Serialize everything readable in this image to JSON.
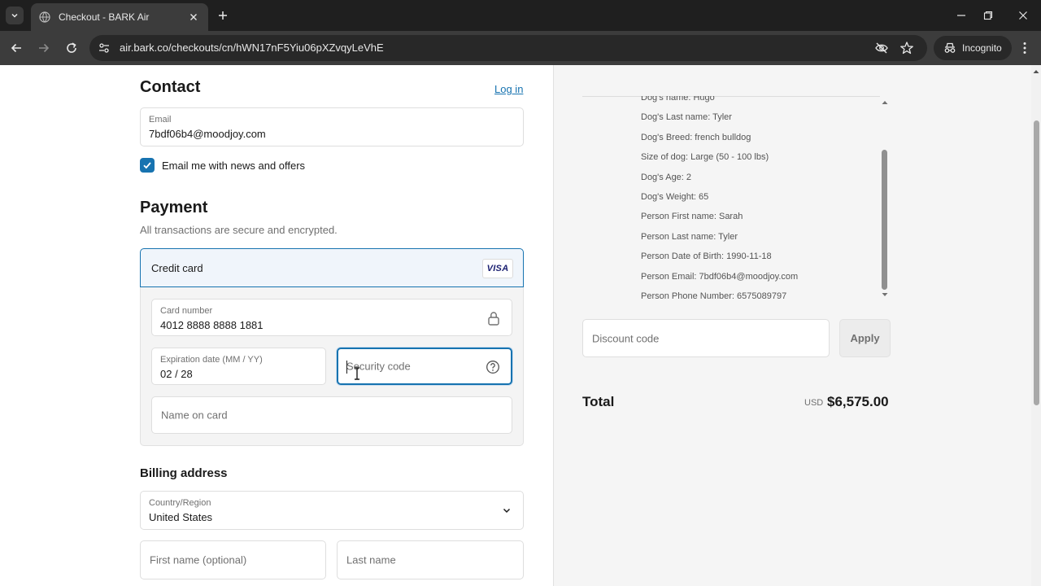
{
  "browser": {
    "tab_title": "Checkout - BARK Air",
    "url": "air.bark.co/checkouts/cn/hWN17nF5Yiu06pXZvqyLeVhE",
    "incognito_label": "Incognito"
  },
  "contact": {
    "title": "Contact",
    "login_label": "Log in",
    "email_label": "Email",
    "email_value": "7bdf06b4@moodjoy.com",
    "newsletter_label": "Email me with news and offers",
    "newsletter_checked": true
  },
  "payment": {
    "title": "Payment",
    "subtitle": "All transactions are secure and encrypted.",
    "method_label": "Credit card",
    "card_brand": "VISA",
    "card_number_label": "Card number",
    "card_number_value": "4012 8888 8888 1881",
    "expiry_label": "Expiration date (MM / YY)",
    "expiry_value": "02 / 28",
    "security_placeholder": "Security code",
    "name_placeholder": "Name on card"
  },
  "billing": {
    "title": "Billing address",
    "country_label": "Country/Region",
    "country_value": "United States",
    "first_name_placeholder": "First name (optional)",
    "last_name_placeholder": "Last name"
  },
  "summary": {
    "attributes": [
      "Dog's name: Hugo",
      "Dog's Last name: Tyler",
      "Dog's Breed: french bulldog",
      "Size of dog: Large (50 - 100 lbs)",
      "Dog's Age: 2",
      "Dog's Weight: 65",
      "Person First name: Sarah",
      "Person Last name: Tyler",
      "Person Date of Birth: 1990-11-18",
      "Person Email: 7bdf06b4@moodjoy.com",
      "Person Phone Number: 6575089797"
    ],
    "discount_placeholder": "Discount code",
    "apply_label": "Apply",
    "total_label": "Total",
    "total_currency": "USD",
    "total_amount": "$6,575.00"
  },
  "colors": {
    "accent": "#1773b0",
    "chrome_dark": "#1f1f1f",
    "chrome_toolbar": "#3c3c3c",
    "summary_bg": "#f5f5f5"
  }
}
